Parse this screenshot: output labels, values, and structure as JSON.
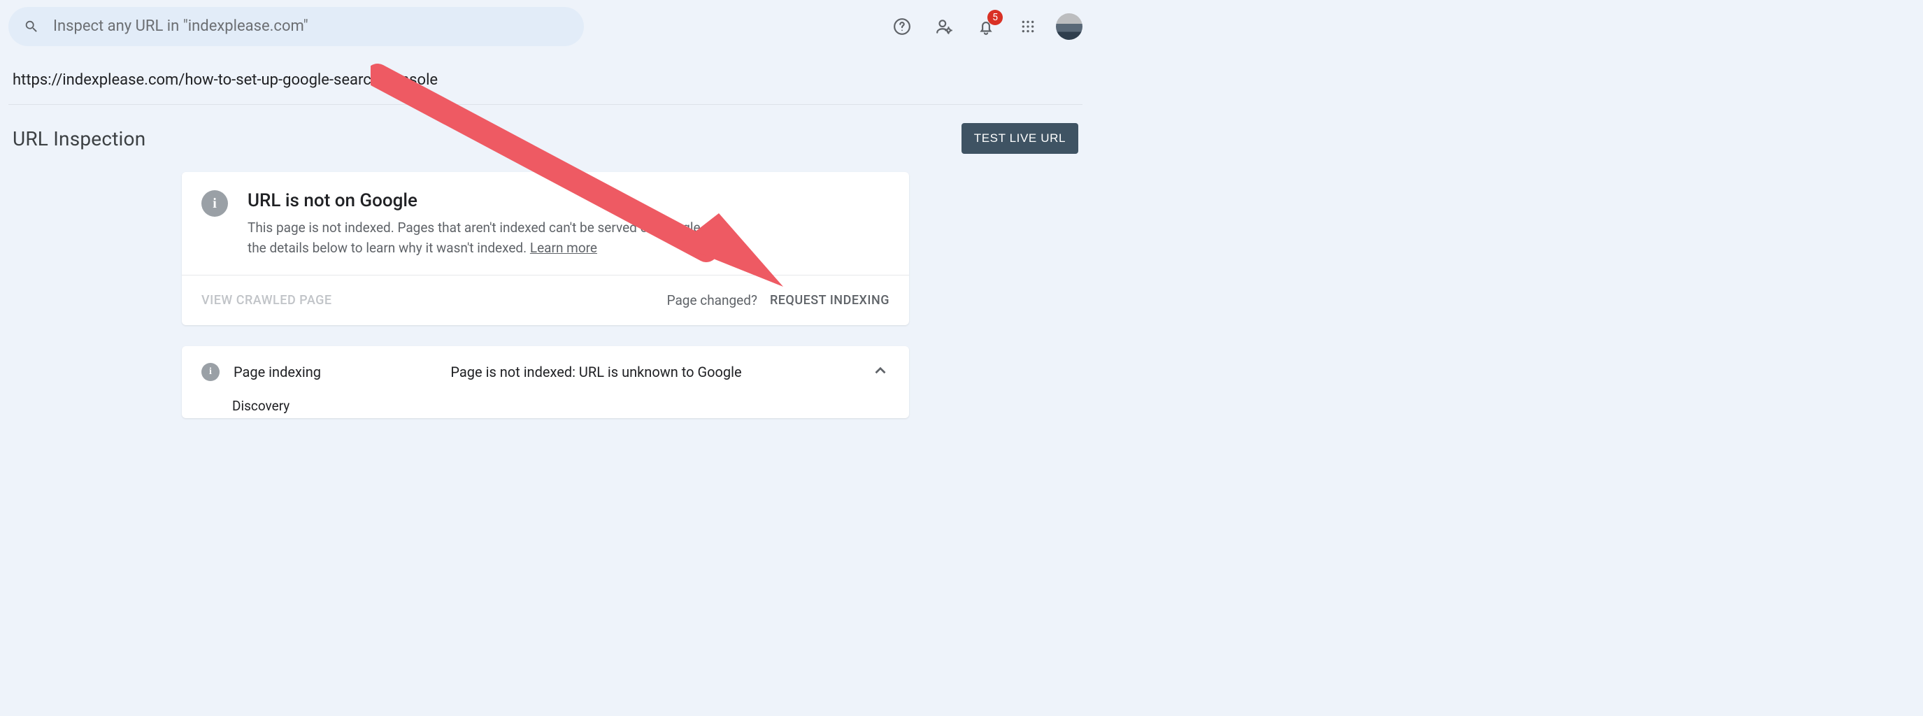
{
  "header": {
    "search_placeholder": "Inspect any URL in \"indexplease.com\"",
    "notification_count": "5"
  },
  "inspected_url": "https://indexplease.com/how-to-set-up-google-search-console",
  "page_title": "URL Inspection",
  "test_live_label": "TEST LIVE URL",
  "status_card": {
    "heading": "URL is not on Google",
    "description": "This page is not indexed. Pages that aren't indexed can't be served on Google. See the details below to learn why it wasn't indexed. ",
    "learn_more": "Learn more",
    "view_crawled": "VIEW CRAWLED PAGE",
    "page_changed": "Page changed?",
    "request_indexing": "REQUEST INDEXING"
  },
  "indexing_card": {
    "label": "Page indexing",
    "status": "Page is not indexed: URL is unknown to Google",
    "discovery": "Discovery"
  }
}
